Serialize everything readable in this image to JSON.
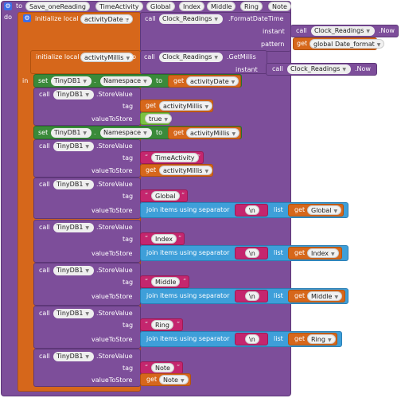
{
  "proc": {
    "to": "to",
    "name": "Save_oneReading",
    "params": [
      "TimeActivity",
      "Global",
      "Index",
      "Middle",
      "Ring",
      "Note"
    ],
    "do": "do"
  },
  "init1": {
    "label": "initialize local",
    "var": "activityDate",
    "to": "to"
  },
  "call_fmt": {
    "call": "call",
    "component": "Clock_Readings",
    "method": ".FormatDateTime"
  },
  "instant1": {
    "label": "instant",
    "call": "call",
    "component": "Clock_Readings",
    "method": ".Now"
  },
  "pattern": {
    "label": "pattern",
    "get": "get",
    "var": "global Date_format"
  },
  "init2": {
    "label": "initialize local",
    "var": "activityMillis",
    "to": "to"
  },
  "call_millis": {
    "call": "call",
    "component": "Clock_Readings",
    "method": ".GetMillis"
  },
  "instant2": {
    "label": "instant",
    "call": "call",
    "component": "Clock_Readings",
    "method": ".Now"
  },
  "in": "in",
  "set1": {
    "set": "set",
    "component": "TinyDB1",
    "prop": "Namespace",
    "to": "to",
    "get": "get",
    "var": "activityDate"
  },
  "store1": {
    "call": "call",
    "component": "TinyDB1",
    "method": ".StoreValue",
    "tag_label": "tag",
    "get": "get",
    "tag_var": "activityMillis",
    "value_label": "valueToStore",
    "value": "true"
  },
  "set2": {
    "set": "set",
    "component": "TinyDB1",
    "prop": "Namespace",
    "to": "to",
    "get": "get",
    "var": "activityMillis"
  },
  "store2": {
    "call": "call",
    "component": "TinyDB1",
    "method": ".StoreValue",
    "tag_label": "tag",
    "tag_text": "TimeActivity",
    "value_label": "valueToStore",
    "get": "get",
    "value_var": "activityMillis"
  },
  "store3": {
    "call": "call",
    "component": "TinyDB1",
    "method": ".StoreValue",
    "tag_label": "tag",
    "tag_text": "Global",
    "value_label": "valueToStore",
    "join": "join items using separator",
    "sep": "\\n",
    "list": "list",
    "get": "get",
    "var": "Global"
  },
  "store4": {
    "call": "call",
    "component": "TinyDB1",
    "method": ".StoreValue",
    "tag_label": "tag",
    "tag_text": "Index",
    "value_label": "valueToStore",
    "join": "join items using separator",
    "sep": "\\n",
    "list": "list",
    "get": "get",
    "var": "Index"
  },
  "store5": {
    "call": "call",
    "component": "TinyDB1",
    "method": ".StoreValue",
    "tag_label": "tag",
    "tag_text": "Middle",
    "value_label": "valueToStore",
    "join": "join items using separator",
    "sep": "\\n",
    "list": "list",
    "get": "get",
    "var": "Middle"
  },
  "store6": {
    "call": "call",
    "component": "TinyDB1",
    "method": ".StoreValue",
    "tag_label": "tag",
    "tag_text": "Ring",
    "value_label": "valueToStore",
    "join": "join items using separator",
    "sep": "\\n",
    "list": "list",
    "get": "get",
    "var": "Ring"
  },
  "store7": {
    "call": "call",
    "component": "TinyDB1",
    "method": ".StoreValue",
    "tag_label": "tag",
    "tag_text": "Note",
    "value_label": "valueToStore",
    "get": "get",
    "value_var": "Note"
  },
  "colors": {
    "procedure": "#7d4e9a",
    "local": "#d6671b",
    "setter": "#3a8a3a",
    "boolean": "#7bc043",
    "text": "#c4266e",
    "list": "#3e9fd9"
  }
}
